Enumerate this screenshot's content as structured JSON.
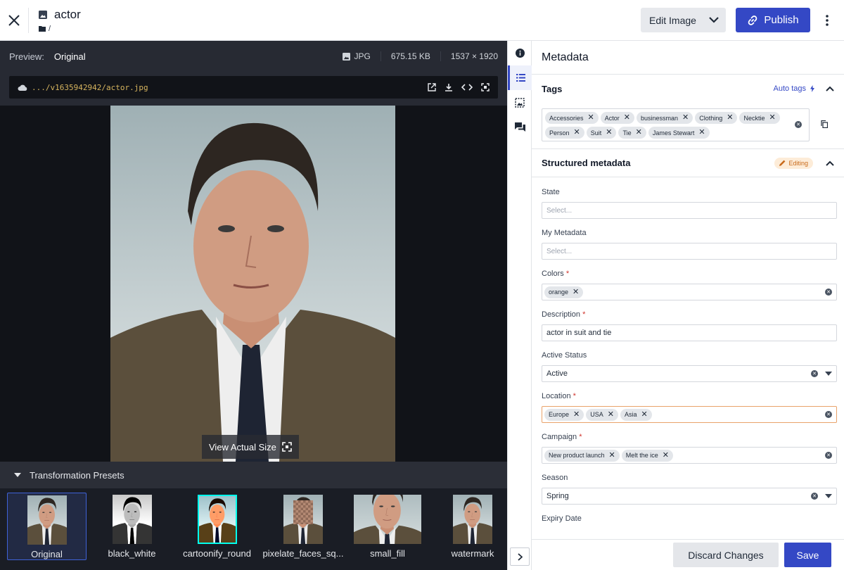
{
  "header": {
    "title": "actor",
    "path": "/",
    "edit_label": "Edit Image",
    "publish_label": "Publish",
    "title_icon": "image-icon",
    "path_icon": "folder-icon"
  },
  "preview": {
    "label": "Preview:",
    "version": "Original",
    "format": "JPG",
    "size": "675.15 KB",
    "dimensions": "1537 × 1920",
    "url": ".../v1635942942/actor.jpg",
    "view_actual": "View Actual Size"
  },
  "presets": {
    "title": "Transformation Presets",
    "items": [
      {
        "label": "Original",
        "style": "color"
      },
      {
        "label": "black_white",
        "style": "bw"
      },
      {
        "label": "cartoonify_round",
        "style": "cartoon"
      },
      {
        "label": "pixelate_faces_sq...",
        "style": "pixel"
      },
      {
        "label": "small_fill",
        "style": "color"
      },
      {
        "label": "watermark",
        "style": "color"
      }
    ]
  },
  "panel": {
    "title": "Metadata",
    "tags_title": "Tags",
    "auto_tags": "Auto tags",
    "tags": [
      "Accessories",
      "Actor",
      "businessman",
      "Clothing",
      "Necktie",
      "Person",
      "Suit",
      "Tie",
      "James Stewart"
    ],
    "structured_title": "Structured metadata",
    "editing_badge": "Editing",
    "fields": {
      "state": {
        "label": "State",
        "placeholder": "Select..."
      },
      "my_metadata": {
        "label": "My Metadata",
        "placeholder": "Select..."
      },
      "colors": {
        "label": "Colors",
        "required": "*",
        "chips": [
          "orange"
        ]
      },
      "description": {
        "label": "Description",
        "required": "*",
        "value": "actor in suit and tie"
      },
      "active_status": {
        "label": "Active Status",
        "value": "Active"
      },
      "location": {
        "label": "Location",
        "required": "*",
        "chips": [
          "Europe",
          "USA",
          "Asia"
        ]
      },
      "campaign": {
        "label": "Campaign",
        "required": "*",
        "chips": [
          "New product launch",
          "Melt the ice"
        ]
      },
      "season": {
        "label": "Season",
        "value": "Spring"
      },
      "expiry": {
        "label": "Expiry Date"
      }
    }
  },
  "footer": {
    "discard_label": "Discard Changes",
    "save_label": "Save"
  },
  "colors": {
    "accent": "#3448c5",
    "dark_bg": "#1a1d25",
    "required": "#d0342c",
    "editing": "#c86a1b",
    "focus_border": "#e9a26a"
  }
}
